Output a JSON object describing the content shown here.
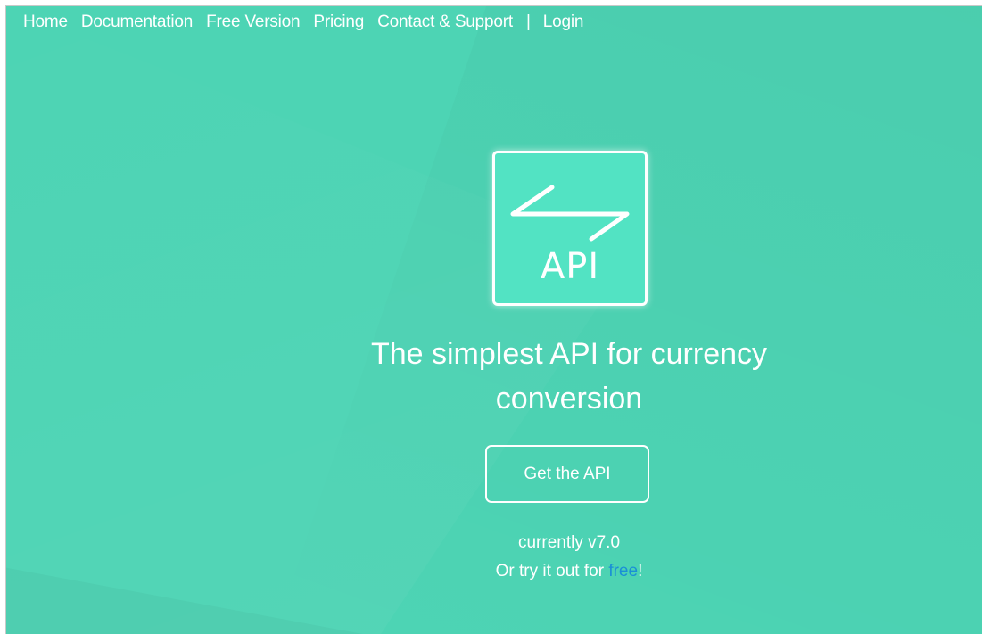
{
  "nav": {
    "items": [
      {
        "label": "Home"
      },
      {
        "label": "Documentation"
      },
      {
        "label": "Free Version"
      },
      {
        "label": "Pricing"
      },
      {
        "label": "Contact & Support"
      }
    ],
    "separator": "|",
    "login": "Login"
  },
  "logo": {
    "text": "API",
    "icon": "exchange-arrows-icon"
  },
  "hero": {
    "headline": "The simplest API for currency conversion",
    "cta_label": "Get the API",
    "version_text": "currently v7.0",
    "try_prefix": "Or try it out for ",
    "try_link": "free",
    "try_suffix": "!"
  },
  "colors": {
    "background": "#4dd4b4",
    "logo_fill": "#52e3c3",
    "text": "#ffffff",
    "link": "#1a8fd6"
  }
}
